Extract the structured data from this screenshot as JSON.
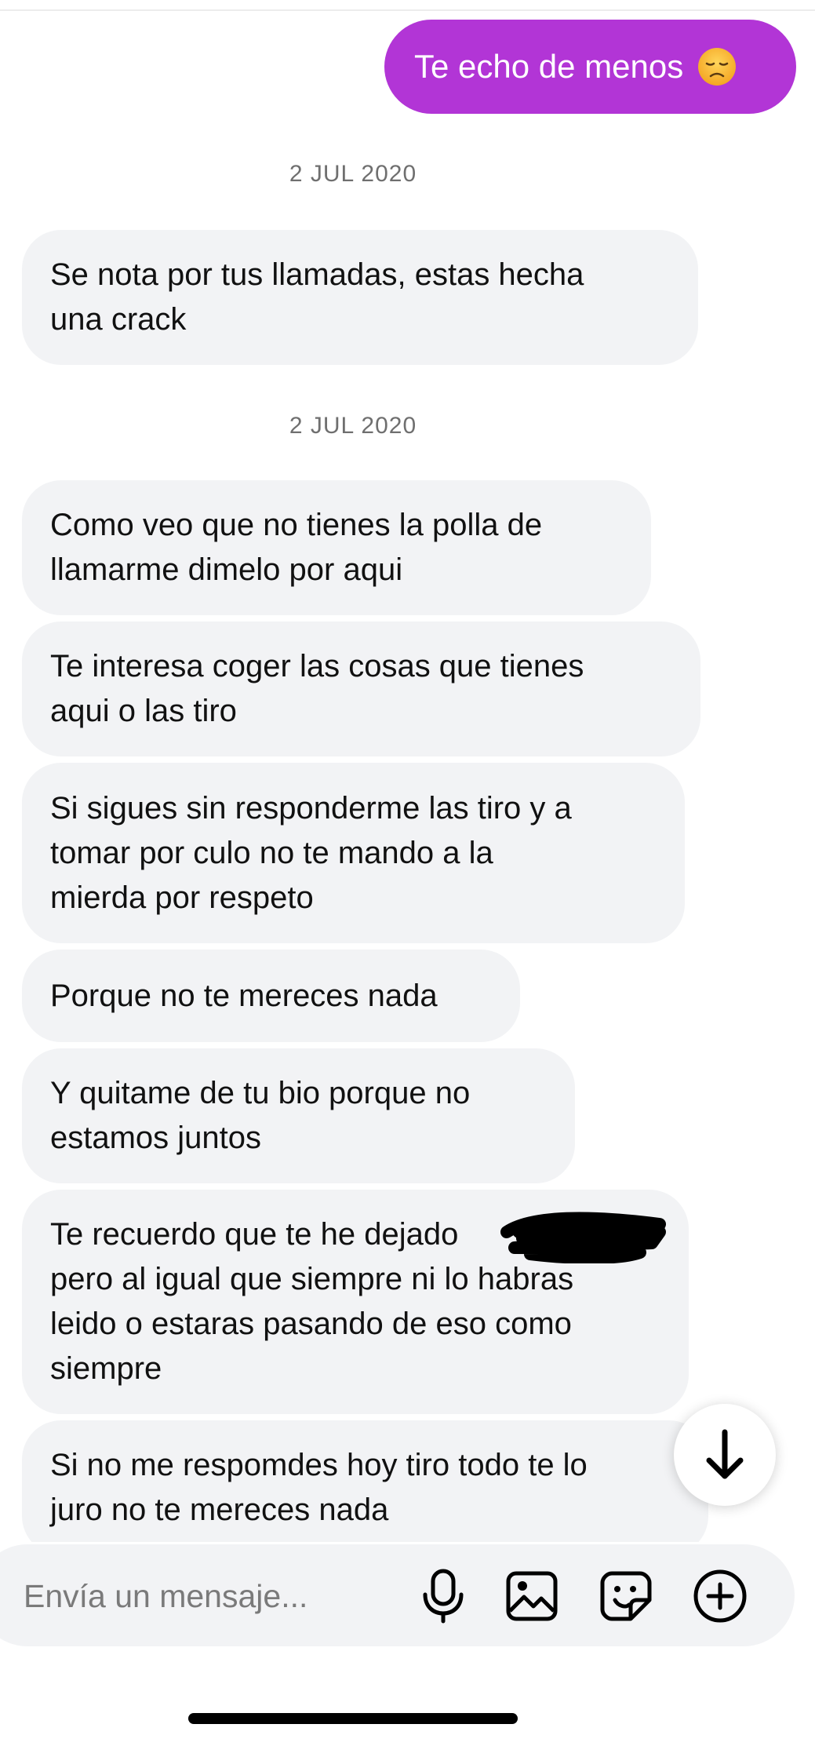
{
  "chat": {
    "sent_messages": [
      {
        "text": "Te echo de menos",
        "emoji": "disappointed-face"
      }
    ],
    "date_separators": [
      "2 JUL 2020",
      "2 JUL 2020"
    ],
    "received_messages": [
      {
        "line1": "Se nota por tus llamadas, estas hecha",
        "line2": "una crack"
      },
      {
        "line1": "Como veo que no tienes la polla de",
        "line2": "llamarme dimelo por aqui"
      },
      {
        "line1": "Te interesa coger las cosas que tienes",
        "line2": "aqui o las tiro"
      },
      {
        "line1": "Si sigues sin responderme las tiro y a",
        "line2": "tomar por culo no te mando a la",
        "line3": "mierda por respeto"
      },
      {
        "line1": "Porque no te mereces nada"
      },
      {
        "line1": "Y quitame de tu bio porque no",
        "line2": "estamos juntos"
      },
      {
        "line1": "Te recuerdo que te he dejado",
        "line2": "pero al igual que siempre ni lo habras",
        "line3": "leido o estaras pasando de eso como",
        "line4": "siempre"
      },
      {
        "line1": "Si no me respomdes hoy tiro todo te lo",
        "line2": "juro no te mereces nada"
      }
    ]
  },
  "composer": {
    "placeholder": "Envía un mensaje...",
    "value": "",
    "icons": [
      "microphone-icon",
      "image-icon",
      "sticker-icon",
      "plus-circle-icon"
    ]
  },
  "colors": {
    "sent_bubble": "#b235d6",
    "received_bubble": "#f2f3f5",
    "date_text": "#6f6f6f"
  }
}
